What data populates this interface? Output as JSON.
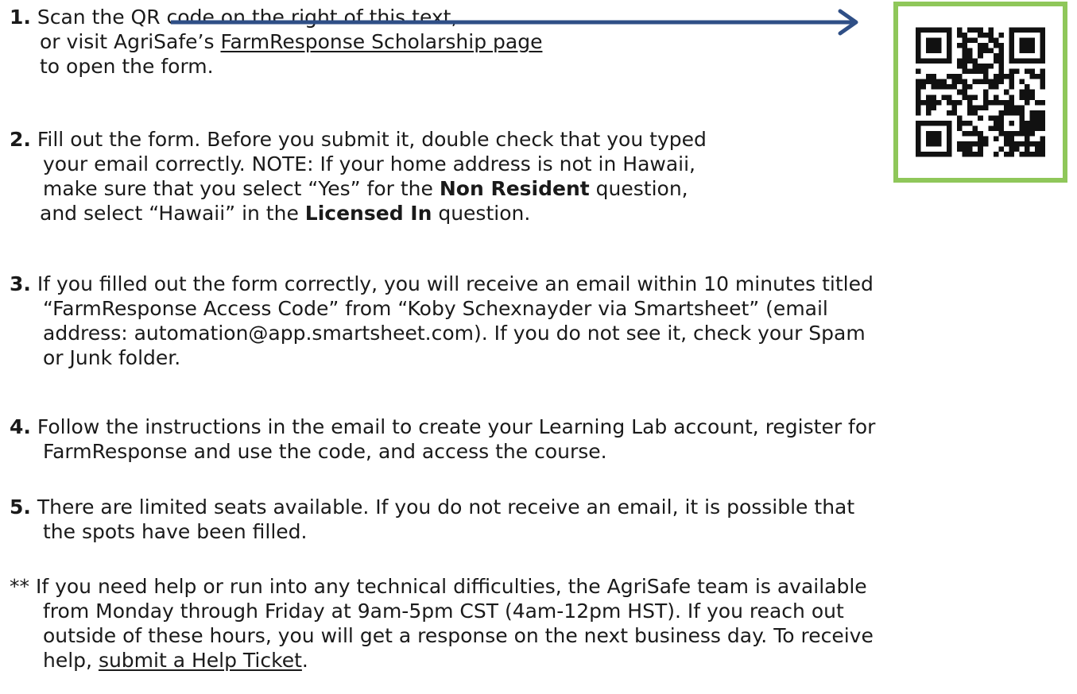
{
  "steps": {
    "s1": {
      "num": "1.",
      "line1": "Scan the QR code on the right of this text,",
      "line2_pre": "or visit AgriSafe’s ",
      "line2_link": "FarmResponse Scholarship page ",
      "line3": "to open the form."
    },
    "s2": {
      "num": "2.",
      "line1": "Fill out the form. Before you submit it, double check that you typed",
      "line2": "your email correctly. NOTE: If your home address is not in Hawaii,",
      "line3_pre": "make sure that you select “Yes” for the ",
      "line3_bold": "Non Resident",
      "line3_post": " question,",
      "line4_pre": "and select “Hawaii” in the ",
      "line4_bold": "Licensed In",
      "line4_post": " question."
    },
    "s3": {
      "num": "3.",
      "line1": "If you filled out the form correctly, you will receive an email within 10 minutes titled",
      "line2": "“FarmResponse Access Code” from “Koby Schexnayder via Smartsheet” (email",
      "line3": "address: automation@app.smartsheet.com). If you do not see it, check your Spam",
      "line4": "or Junk folder."
    },
    "s4": {
      "num": "4.",
      "line1": "Follow the instructions in the email to create your Learning Lab account, register for",
      "line2": "FarmResponse and use the code, and access the course."
    },
    "s5": {
      "num": "5.",
      "line1": "There are limited seats available. If you do not receive an email, it is possible that",
      "line2": "the spots have been filled."
    },
    "note": {
      "marker": "**",
      "line1": "If you need help or run into any technical difficulties, the AgriSafe team is available",
      "line2": "from Monday through Friday at 9am-5pm CST (4am-12pm HST). If you reach out",
      "line3": "outside of these hours, you will get a response on the next business day. To receive",
      "line4_pre": "help, ",
      "line4_link": "submit a Help Ticket",
      "line4_post": "."
    }
  },
  "colors": {
    "arrow": "#2f4f86",
    "qr_frame": "#8fc75a",
    "text": "#1a1a1a"
  },
  "icons": {
    "arrow": "arrow-right-icon",
    "qr": "qr-code-icon"
  }
}
